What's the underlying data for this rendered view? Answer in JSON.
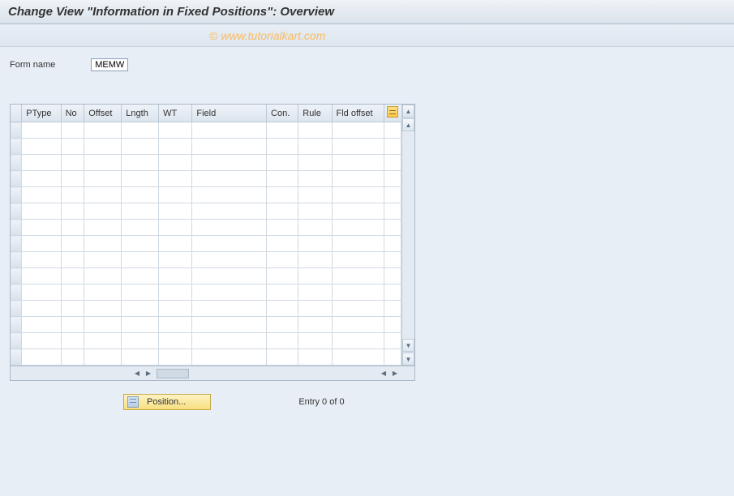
{
  "title": "Change View \"Information in Fixed Positions\": Overview",
  "watermark": "© www.tutorialkart.com",
  "form": {
    "label": "Form name",
    "value": "MEMW"
  },
  "table": {
    "columns": [
      "PType",
      "No",
      "Offset",
      "Lngth",
      "WT",
      "Field",
      "Con.",
      "Rule",
      "Fld offset"
    ],
    "row_count_visible": 15
  },
  "footer": {
    "position_button": "Position...",
    "entry_text": "Entry 0 of 0"
  },
  "icons": {
    "config": "table-settings-icon",
    "scroll_up": "▲",
    "scroll_down": "▼",
    "scroll_left": "◀",
    "scroll_right": "▶"
  }
}
